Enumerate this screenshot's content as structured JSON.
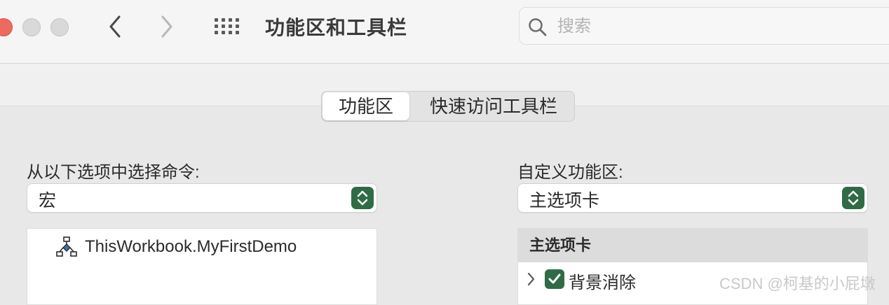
{
  "window": {
    "title": "功能区和工具栏",
    "controls": [
      "close",
      "minimize",
      "zoom"
    ],
    "nav": {
      "back_icon": "chevron-left-icon",
      "forward_icon": "chevron-right-icon",
      "grid_icon": "grid-icon"
    }
  },
  "search": {
    "placeholder": "搜索",
    "value": ""
  },
  "tabs": [
    {
      "label": "功能区",
      "selected": true
    },
    {
      "label": "快速访问工具栏",
      "selected": false
    }
  ],
  "left": {
    "label": "从以下选项中选择命令:",
    "select_value": "宏",
    "items": [
      {
        "label": "ThisWorkbook.MyFirstDemo",
        "icon": "macro-icon"
      }
    ]
  },
  "right": {
    "label": "自定义功能区:",
    "select_value": "主选项卡",
    "tree_header": "主选项卡",
    "tree_items": [
      {
        "label": "背景消除",
        "checked": true,
        "expanded": false
      }
    ]
  },
  "watermark": "CSDN @柯基的小屁墩",
  "colors": {
    "accent": "#2f6b45",
    "close": "#ec6a5e"
  }
}
